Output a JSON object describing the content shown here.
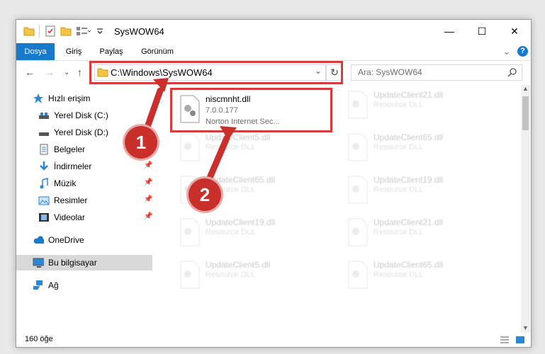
{
  "window": {
    "title": "SysWOW64",
    "minimize": "—",
    "maximize": "☐",
    "close": "✕"
  },
  "ribbon": {
    "tabs": [
      {
        "label": "Dosya",
        "active": true
      },
      {
        "label": "Giriş",
        "active": false
      },
      {
        "label": "Paylaş",
        "active": false
      },
      {
        "label": "Görünüm",
        "active": false
      }
    ],
    "collapse": "⌄",
    "help": "?"
  },
  "nav": {
    "address": "C:\\Windows\\SysWOW64",
    "search_placeholder": "Ara: SysWOW64"
  },
  "sidebar": {
    "items": [
      {
        "label": "Hızlı erişim"
      },
      {
        "label": "Yerel Disk (C:)"
      },
      {
        "label": "Yerel Disk (D:)"
      },
      {
        "label": "Belgeler"
      },
      {
        "label": "İndirmeler"
      },
      {
        "label": "Müzik"
      },
      {
        "label": "Resimler"
      },
      {
        "label": "Videolar"
      },
      {
        "label": "OneDrive"
      },
      {
        "label": "Bu bilgisayar"
      },
      {
        "label": "Ağ"
      }
    ]
  },
  "files": [
    {
      "name": "niscmnht.dll",
      "version": "7.0.0.177",
      "desc": "Norton Internet Sec..."
    },
    {
      "name": "UpdateClient21.dll",
      "version": "",
      "desc": "Resource DLL"
    },
    {
      "name": "UpdateClient5.dll",
      "version": "",
      "desc": "Resource DLL"
    },
    {
      "name": "UpdateClient65.dll",
      "version": "",
      "desc": "Resource DLL"
    },
    {
      "name": "UpdateClient65.dll",
      "version": "",
      "desc": "Resource DLL"
    },
    {
      "name": "UpdateClient19.dll",
      "version": "",
      "desc": "Resource DLL"
    },
    {
      "name": "UpdateClient19.dll",
      "version": "",
      "desc": "Resource DLL"
    },
    {
      "name": "UpdateClient21.dll",
      "version": "",
      "desc": "Resource DLL"
    },
    {
      "name": "UpdateClient5.dll",
      "version": "",
      "desc": "Resource DLL"
    },
    {
      "name": "UpdateClient65.dll",
      "version": "",
      "desc": "Resource DLL"
    }
  ],
  "status": {
    "count": "160 öğe"
  },
  "annotations": {
    "step1": "1",
    "step2": "2",
    "highlight_color": "#d73b3b"
  }
}
